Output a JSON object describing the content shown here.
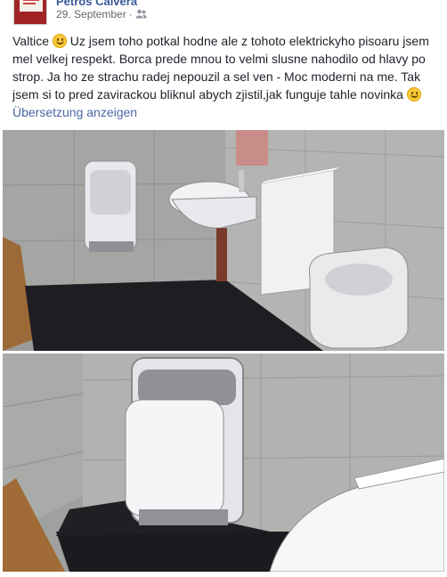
{
  "post": {
    "author": "Petros Calvera",
    "date": "29. September",
    "separator": "·",
    "audience_icon": "friends-icon",
    "text_segments": [
      "Valtice ",
      " Uz jsem toho potkal hodne ale z tohoto elektrickyho pisoaru jsem mel velkej respekt. Borca prede mnou to velmi slusne nahodilo od hlavy po strop. Ja ho ze strachu radej nepouzil a sel ven - Moc moderni na me. Tak jsem si to pred zavirackou bliknul abych zjistil,jak funguje tahle novinka "
    ],
    "translate_label": "Übersetzung anzeigen",
    "photos": [
      {
        "name": "restroom-photo-1",
        "icon": "restroom-hand-dryer-urinal-image"
      },
      {
        "name": "restroom-photo-2",
        "icon": "hand-dryer-closeup-image"
      }
    ]
  },
  "colors": {
    "link": "#385898",
    "translate_link": "#4b67a1",
    "meta": "#616770",
    "text": "#1d2129"
  }
}
